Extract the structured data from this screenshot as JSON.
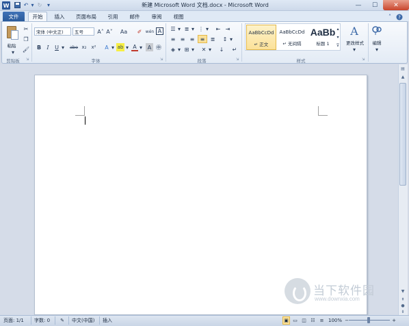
{
  "title": "新建 Microsoft Word 文档.docx - Microsoft Word",
  "app_logo": "W",
  "quick_access": {
    "save_icon": "save-icon",
    "undo": "↶",
    "redo": "↻",
    "customize": "▾"
  },
  "window_controls": {
    "minimize": "—",
    "maximize": "☐",
    "close": "✕"
  },
  "tabs": [
    {
      "label": "文件"
    },
    {
      "label": "开始"
    },
    {
      "label": "插入"
    },
    {
      "label": "页面布局"
    },
    {
      "label": "引用"
    },
    {
      "label": "邮件"
    },
    {
      "label": "审阅"
    },
    {
      "label": "视图"
    }
  ],
  "ribbon": {
    "clipboard": {
      "label": "剪贴板",
      "paste": "粘贴"
    },
    "font": {
      "label": "字体",
      "font_name": "宋体 (中文正)",
      "font_size": "五号",
      "buttons": {
        "grow": "A˄",
        "shrink": "A˅",
        "case": "Aa",
        "clear": "✐",
        "phonetic": "wén",
        "border": "A"
      },
      "format": {
        "bold": "B",
        "italic": "I",
        "underline": "U",
        "strike": "abe",
        "subscript": "x₂",
        "superscript": "x²",
        "effects": "A",
        "highlight": "ab",
        "color": "A",
        "shading": "A",
        "enclose": "㊥"
      }
    },
    "paragraph": {
      "label": "段落"
    },
    "styles": {
      "label": "样式",
      "items": [
        {
          "preview": "AaBbCcDd",
          "name": "↵ 正文"
        },
        {
          "preview": "AaBbCcDd",
          "name": "↵ 无间隔"
        },
        {
          "preview": "AaBb",
          "name": "标题 1"
        }
      ],
      "change_styles": "更改样式"
    },
    "editing": {
      "label": "编辑"
    }
  },
  "status": {
    "page": "页面: 1/1",
    "words": "字数: 0",
    "language": "中文(中国)",
    "mode": "插入",
    "zoom": "100%",
    "zoom_out": "−",
    "zoom_in": "+"
  },
  "watermark": {
    "text": "当下软件园",
    "url": "www.downxia.com"
  },
  "colors": {
    "file_tab": "#2b579a",
    "accent": "#2b579a",
    "close": "#c9442b",
    "style_selected": "#fbe199"
  }
}
